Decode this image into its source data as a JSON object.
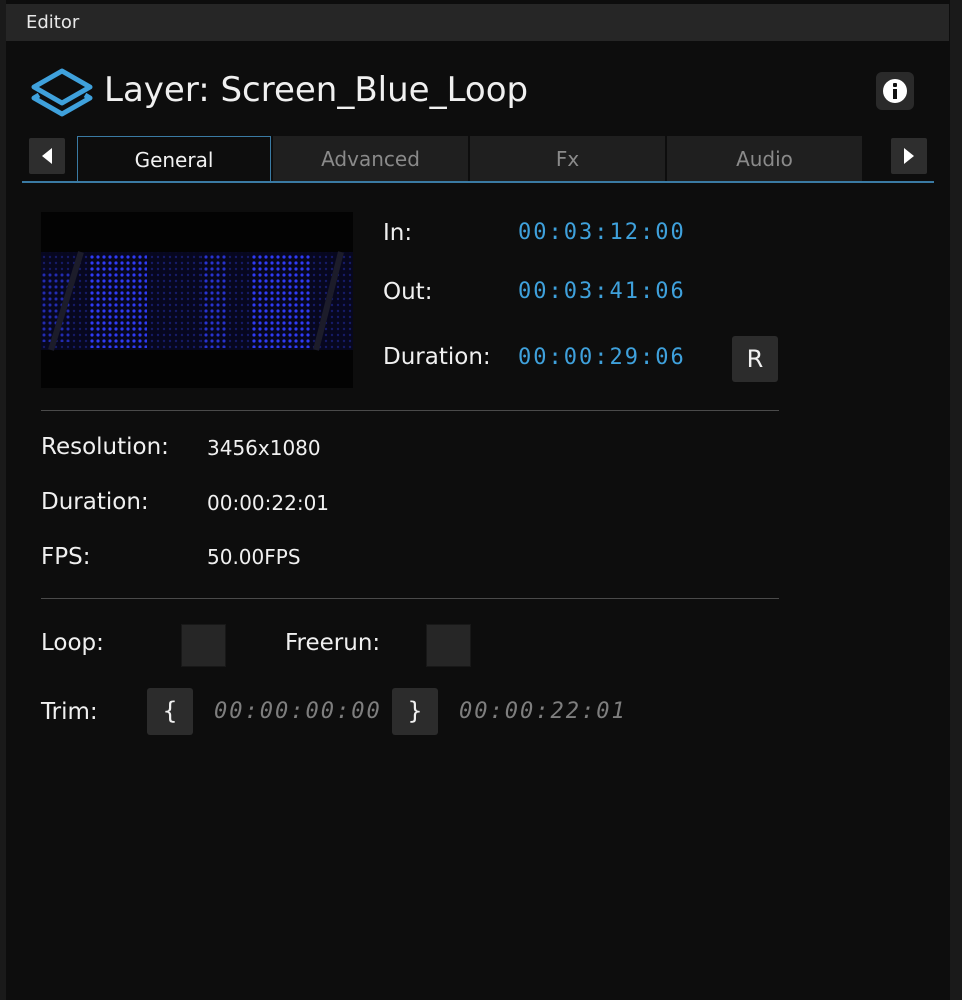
{
  "window": {
    "title": "Editor"
  },
  "header": {
    "title": "Layer: Screen_Blue_Loop"
  },
  "tabs": [
    {
      "label": "General",
      "active": true
    },
    {
      "label": "Advanced",
      "active": false
    },
    {
      "label": "Fx",
      "active": false
    },
    {
      "label": "Audio",
      "active": false
    }
  ],
  "timing": {
    "in_label": "In:",
    "in_value": "00:03:12:00",
    "out_label": "Out:",
    "out_value": "00:03:41:06",
    "duration_label": "Duration:",
    "duration_value": "00:00:29:06",
    "reset_label": "R"
  },
  "media": {
    "resolution_label": "Resolution:",
    "resolution_value": "3456x1080",
    "duration_label": "Duration:",
    "duration_value": "00:00:22:01",
    "fps_label": "FPS:",
    "fps_value": "50.00FPS"
  },
  "options": {
    "loop_label": "Loop:",
    "loop_checked": false,
    "freerun_label": "Freerun:",
    "freerun_checked": false,
    "trim_label": "Trim:",
    "trim_in_button": "{",
    "trim_in_value": "00:00:00:00",
    "trim_out_button": "}",
    "trim_out_value": "00:00:22:01"
  },
  "icons": {
    "layers": "layers-icon",
    "info": "info-icon",
    "prev": "arrow-left-icon",
    "next": "arrow-right-icon"
  },
  "colors": {
    "accent": "#3fa1dc",
    "tab_line": "#3a7aa3",
    "background": "#0d0d0d"
  }
}
